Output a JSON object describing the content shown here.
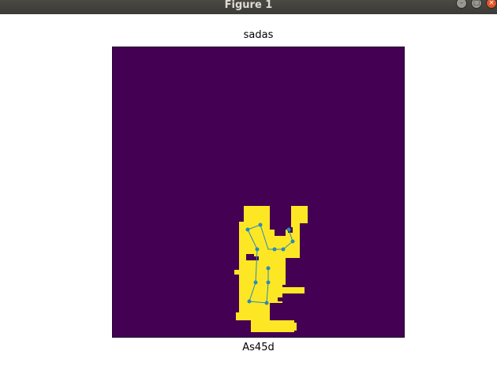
{
  "window": {
    "title": "Figure 1",
    "buttons": {
      "minimize": "–",
      "maximize": "□",
      "close": "×"
    }
  },
  "figure": {
    "title": "sadas",
    "xlabel": "As45d",
    "colors": {
      "background": "#440154",
      "foreground": "#fde725",
      "skeleton": "#2a8ab8"
    }
  },
  "chart_data": {
    "type": "heatmap",
    "description_of_content": "binary mask with overlaid keypoint skeleton",
    "title": "sadas",
    "xlabel": "As45d",
    "ylabel": "",
    "grid": false,
    "legend": "none"
  }
}
